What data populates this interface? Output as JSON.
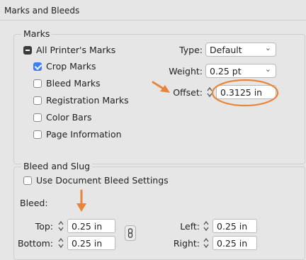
{
  "header": {
    "title": "Marks and Bleeds"
  },
  "marks": {
    "legend": "Marks",
    "all_printers_marks": "All Printer's Marks",
    "crop_marks": "Crop Marks",
    "bleed_marks": "Bleed Marks",
    "registration_marks": "Registration Marks",
    "color_bars": "Color Bars",
    "page_information": "Page Information",
    "type_label": "Type:",
    "type_value": "Default",
    "weight_label": "Weight:",
    "weight_value": "0.25 pt",
    "offset_label": "Offset:",
    "offset_value": "0.3125 in"
  },
  "bleed_slug": {
    "legend": "Bleed and Slug",
    "use_document_bleed": "Use Document Bleed Settings",
    "bleed_label": "Bleed:",
    "top_label": "Top:",
    "top_value": "0.25 in",
    "bottom_label": "Bottom:",
    "bottom_value": "0.25 in",
    "left_label": "Left:",
    "left_value": "0.25 in",
    "right_label": "Right:",
    "right_value": "0.25 in"
  },
  "colors": {
    "annotation": "#e8853a",
    "checkbox_accent": "#3d7ef1"
  }
}
